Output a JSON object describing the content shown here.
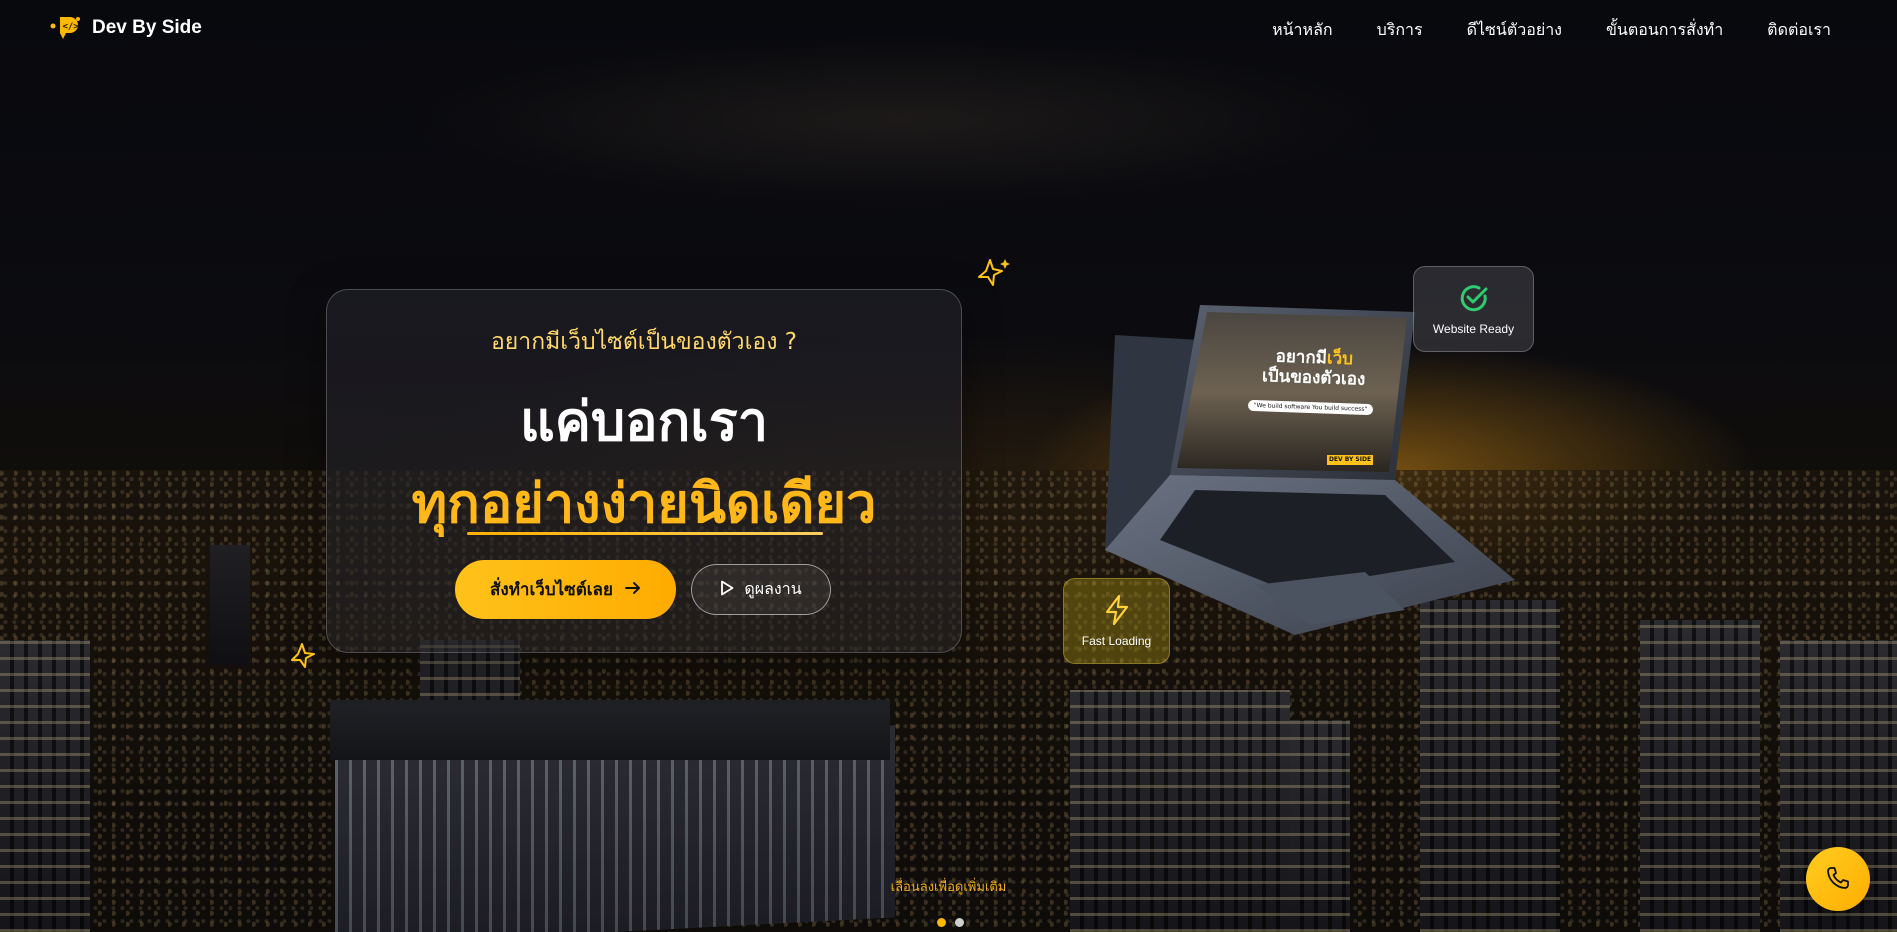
{
  "brand": {
    "name": "Dev By Side",
    "icon": "code-pin-icon"
  },
  "nav": {
    "items": [
      {
        "label": "หน้าหลัก"
      },
      {
        "label": "บริการ"
      },
      {
        "label": "ดีไซน์ตัวอย่าง"
      },
      {
        "label": "ขั้นตอนการสั่งทำ"
      },
      {
        "label": "ติดต่อเรา"
      }
    ]
  },
  "hero": {
    "kicker": "อยากมีเว็บไซต์เป็นของตัวเอง ?",
    "title_line1": "แค่บอกเรา",
    "title_line2": "ทุกอย่างง่ายนิดเดียว",
    "primary_button": {
      "label": "สั่งทำเว็บไซต์เลย",
      "icon": "arrow-right-icon"
    },
    "secondary_button": {
      "label": "ดูผลงาน",
      "icon": "play-icon"
    }
  },
  "laptop_screen": {
    "headline_part1": "อยากมี",
    "headline_accent": "เว็บ",
    "headline_part2": "เป็นของตัวเอง",
    "tagline": "\"We build software You build success\"",
    "brand": "DEV BY SIDE"
  },
  "badges": {
    "ready": {
      "label": "Website Ready",
      "icon": "check-circle-icon"
    },
    "fast": {
      "label": "Fast Loading",
      "icon": "lightning-icon"
    }
  },
  "scroll_hint": "เลื่อนลงเพื่อดูเพิ่มเติม",
  "carousel": {
    "count": 2,
    "active_index": 0
  },
  "call_button": {
    "icon": "phone-icon"
  },
  "colors": {
    "accent": "#ffb800",
    "accent_light": "#ffd76a",
    "success": "#2ecc71"
  }
}
